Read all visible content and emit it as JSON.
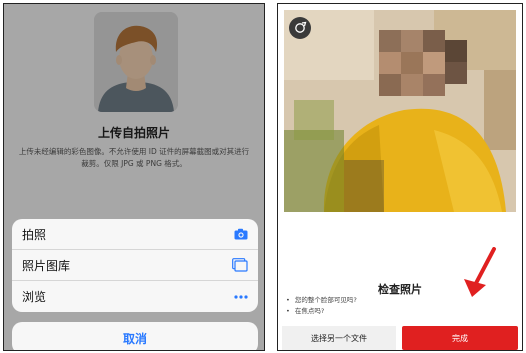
{
  "left": {
    "title": "上传自拍照片",
    "description": "上传未经编辑的彩色图像。不允许使用 ID 证件的屏幕截图或对其进行裁剪。仅限 JPG 或 PNG 格式。",
    "sheet_items": [
      {
        "label": "拍照",
        "icon": "camera-icon"
      },
      {
        "label": "照片图库",
        "icon": "photo-library-icon"
      },
      {
        "label": "浏览",
        "icon": "more-dots-icon"
      }
    ],
    "cancel_label": "取消"
  },
  "right": {
    "title": "检查照片",
    "checks": [
      "您的整个脸部可见吗?",
      "在焦点吗?"
    ],
    "secondary_button": "选择另一个文件",
    "primary_button": "完成"
  },
  "colors": {
    "accent_blue": "#2979ff",
    "primary_red": "#e02020",
    "photo_yellow": "#e8b21a"
  }
}
